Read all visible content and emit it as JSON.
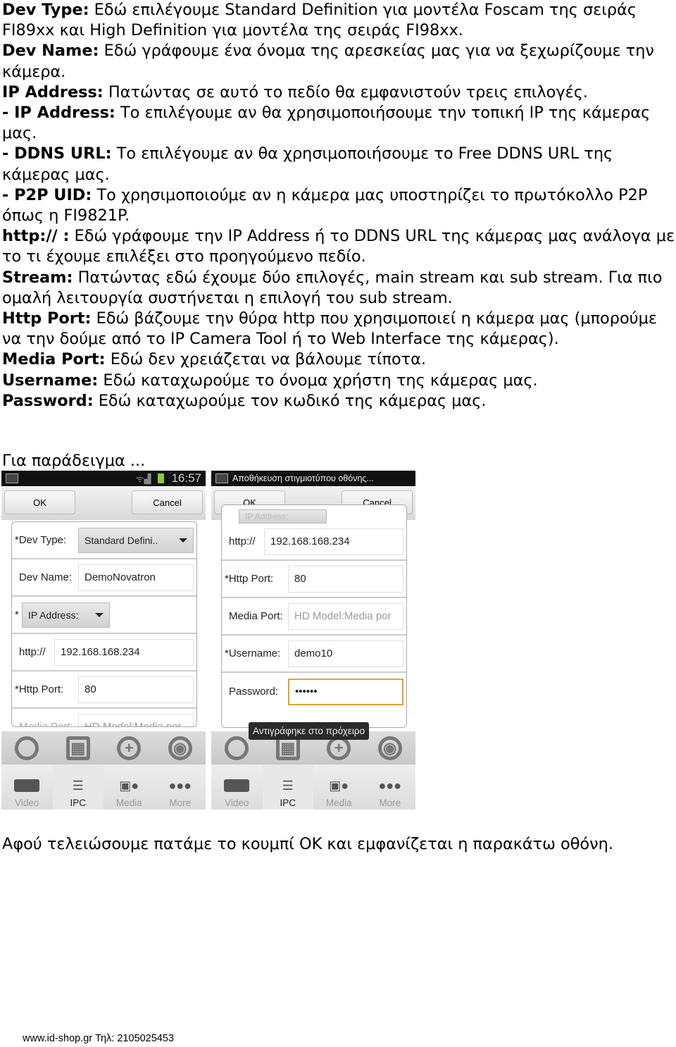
{
  "paragraphs": [
    {
      "bold": "Dev Type:",
      "text": " Εδώ επιλέγουμε Standard Definition για μοντέλα Foscam της σειράς FI89xx και High Definition για μοντέλα της σειράς FI98xx."
    },
    {
      "bold": "Dev Name:",
      "text": " Εδώ γράφουμε ένα όνομα της αρεσκείας μας για να ξεχωρίζουμε την κάμερα."
    },
    {
      "bold": "IP Address:",
      "text": " Πατώντας σε αυτό το πεδίο θα εμφανιστούν τρεις επιλογές."
    },
    {
      "bold": "- IP Address:",
      "text": " Το επιλέγουμε αν θα χρησιμοποιήσουμε την τοπική IP της κάμερας μας."
    },
    {
      "bold": "- DDNS URL:",
      "text": " Το επιλέγουμε αν θα χρησιμοποιήσουμε το Free DDNS URL της κάμερας μας."
    },
    {
      "bold": "- P2P UID:",
      "text": " Το χρησιμοποιούμε αν η κάμερα μας υποστηρίζει το πρωτόκολλο P2P όπως η FI9821P."
    },
    {
      "bold": "http:// :",
      "text": " Εδώ γράφουμε την IP Address ή το DDNS URL της κάμερας μας ανάλογα με το τι έχουμε επιλέξει στο προηγούμενο πεδίο."
    },
    {
      "bold": "Stream:",
      "text": " Πατώντας εδώ έχουμε δύο επιλογές, main stream και sub stream. Για πιο ομαλή λειτουργία συστήνεται η επιλογή του sub stream."
    },
    {
      "bold": "Http Port:",
      "text": " Εδώ βάζουμε την θύρα http που χρησιμοποιεί η κάμερα μας (μπορούμε να την δούμε από το IP Camera Tool ή το Web Interface της κάμερας)."
    },
    {
      "bold": "Media Port:",
      "text": " Εδώ δεν χρειάζεται να βάλουμε τίποτα."
    },
    {
      "bold": "Username:",
      "text": " Εδώ καταχωρούμε το όνομα χρήστη της κάμερας μας."
    },
    {
      "bold": "Password:",
      "text": " Εδώ καταχωρούμε τον κωδικό της κάμερας μας."
    }
  ],
  "example_label": "Για παράδειγμα ...",
  "after_text": "Αφού τελειώσουμε πατάμε το κουμπί OK και εμφανίζεται η παρακάτω οθόνη.",
  "footer": "www.id-shop.gr  Τηλ: 2105025453",
  "phone1": {
    "time": "16:57",
    "ok": "OK",
    "cancel": "Cancel",
    "dev_type_label": "*Dev Type:",
    "dev_type_value": "Standard Defini..",
    "dev_name_label": "Dev Name:",
    "dev_name_value": "DemoNovatron",
    "ip_star": "*",
    "ip_dropdown": "IP Address:",
    "http_label": "http://",
    "http_value": "192.168.168.234",
    "port_label": "*Http Port:",
    "port_value": "80",
    "media_label": "Media Port:",
    "media_placeholder": "HD Model:Media por"
  },
  "phone2": {
    "title": "Αποθήκευση στιγμιοτύπου οθόνης...",
    "ok": "OK",
    "cancel": "Cancel",
    "ip_dropdown": "IP Address:",
    "http_label": "http://",
    "http_value": "192.168.168.234",
    "port_label": "*Http Port:",
    "port_value": "80",
    "media_label": "Media Port:",
    "media_placeholder": "HD Model:Media por",
    "user_label": "*Username:",
    "user_value": "demo10",
    "pass_label": "Password:",
    "pass_value": "••••••",
    "toast": "Αντιγράφηκε στο πρόχειρο"
  },
  "tabs": [
    "Video",
    "IPC",
    "Media",
    "More"
  ],
  "active_tab": "IPC",
  "accent_focus": "#e0a030"
}
